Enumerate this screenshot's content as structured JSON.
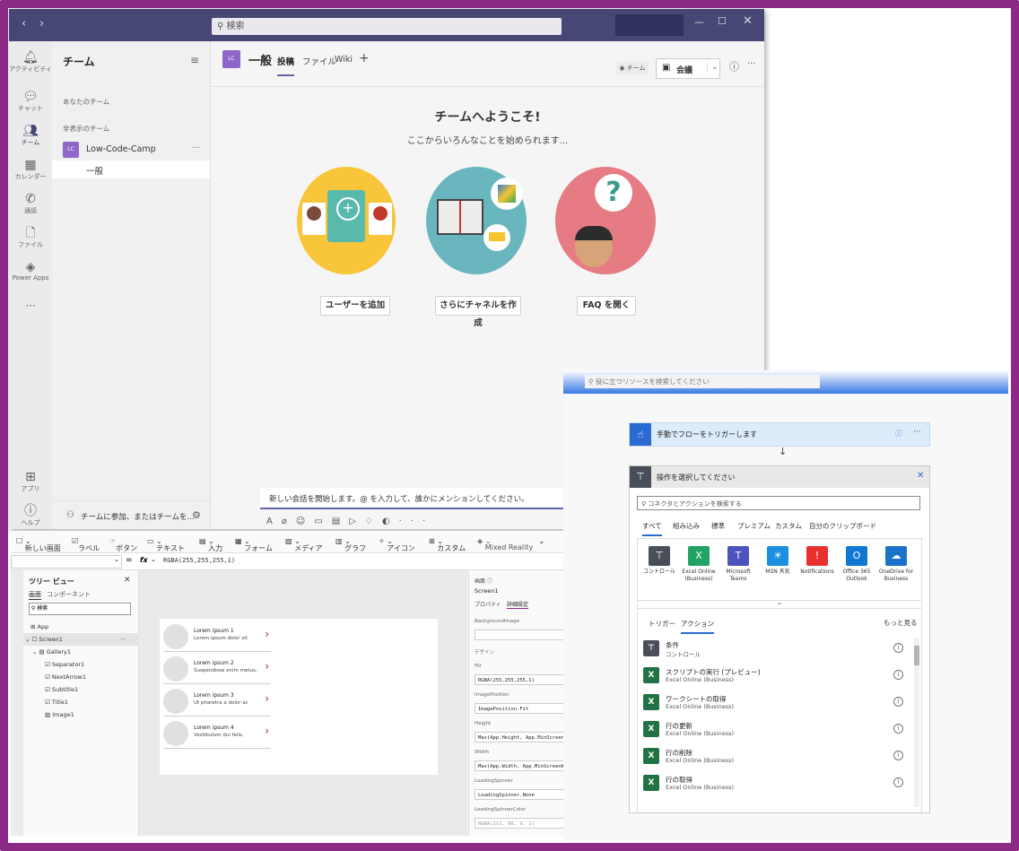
{
  "teams": {
    "search_placeholder": "検索",
    "rail": [
      "アクティビティ",
      "チャット",
      "チーム",
      "カレンダー",
      "通話",
      "ファイル",
      "Power Apps",
      "アプリ",
      "ヘルプ"
    ],
    "list_title": "チーム",
    "section_your_teams": "あなたのチーム",
    "section_hidden": "非表示のチーム",
    "team_badge": "LC",
    "team_name": "Low-Code-Camp",
    "channel_general": "一般",
    "join_text": "チームに参加、またはチームを...",
    "channel_title": "一般",
    "tabs": [
      "投稿",
      "ファイル",
      "Wiki"
    ],
    "team_chip": "チーム",
    "meet_label": "会議",
    "welcome_title": "チームへようこそ!",
    "welcome_sub": "ここからいろんなことを始められます...",
    "actions": [
      "ユーザーを追加",
      "さらにチャネルを作成",
      "FAQ を開く"
    ],
    "compose_placeholder": "新しい会話を開始します。@ を入力して、誰かにメンションしてください。"
  },
  "powerapps": {
    "ribbon": [
      "新しい画面",
      "ラベル",
      "ボタン",
      "テキスト",
      "入力",
      "フォーム",
      "メディア",
      "グラフ",
      "アイコン",
      "カスタム",
      "Mixed Reality"
    ],
    "formula_label": "fx",
    "formula_value": "RGBA(255,255,255,1)",
    "tree_title": "ツリー ビュー",
    "tree_tabs": [
      "画面",
      "コンポーネント"
    ],
    "tree_search": "検索",
    "tree_items": [
      "App",
      "Screen1",
      "Gallery1",
      "Separator1",
      "NextArrow1",
      "Subtitle1",
      "Title1",
      "Image1"
    ],
    "gallery": [
      {
        "title": "Lorem ipsum 1",
        "sub": "Lorem ipsum dolor sit"
      },
      {
        "title": "Lorem ipsum 2",
        "sub": "Suspendisse enim metus,"
      },
      {
        "title": "Lorem ipsum 3",
        "sub": "Ut pharetra a dolor ac"
      },
      {
        "title": "Lorem ipsum 4",
        "sub": "Vestibulum dui felis,"
      }
    ],
    "props_header": "画面",
    "props_screen": "Screen1",
    "props_tabs": [
      "プロパティ",
      "詳細設定"
    ],
    "props": [
      {
        "label": "BackgroundImage",
        "value": ""
      },
      {
        "label": "デザイン",
        "value": ""
      },
      {
        "label": "Fill",
        "value": "RGBA(255,255,255,1)"
      },
      {
        "label": "ImagePosition",
        "value": "ImagePosition.Fit"
      },
      {
        "label": "Height",
        "value": "Max(App.Height, App.MinScreenHeight)"
      },
      {
        "label": "Width",
        "value": "Max(App.Width, App.MinScreenWidth)"
      },
      {
        "label": "LoadingSpinner",
        "value": "LoadingSpinner.None"
      },
      {
        "label": "LoadingSpinnerColor",
        "value": "RGBA(211, 66, 9, 1)"
      }
    ]
  },
  "automate": {
    "search_placeholder": "役に立つリソースを検索してください",
    "trigger_title": "手動でフローをトリガーします",
    "op_title": "操作を選択してください",
    "op_search": "コネクタとアクションを検索する",
    "cat_tabs": [
      "すべて",
      "組み込み",
      "標準",
      "プレミアム",
      "カスタム",
      "自分のクリップボード"
    ],
    "connectors": [
      {
        "label": "コントロール",
        "color": "#484f58",
        "icon": "⊤"
      },
      {
        "label": "Excel Online (Business)",
        "color": "#21a366",
        "icon": "X"
      },
      {
        "label": "Microsoft Teams",
        "color": "#4b53bc",
        "icon": "T"
      },
      {
        "label": "MSN 天気",
        "color": "#1b8ee0",
        "icon": "☀"
      },
      {
        "label": "Notifications",
        "color": "#e8312f",
        "icon": "🔔"
      },
      {
        "label": "Office 365 Outlook",
        "color": "#0f78d4",
        "icon": "O"
      },
      {
        "label": "OneDrive for Business",
        "color": "#1a73c8",
        "icon": "☁"
      }
    ],
    "sub_tabs": [
      "トリガー",
      "アクション"
    ],
    "see_more": "もっと見る",
    "actions": [
      {
        "title": "条件",
        "sub": "コントロール",
        "color": "#484f58",
        "icon": "⊤"
      },
      {
        "title": "スクリプトの実行 (プレビュー)",
        "sub": "Excel Online (Business)",
        "color": "#217346",
        "icon": "X"
      },
      {
        "title": "ワークシートの取得",
        "sub": "Excel Online (Business)",
        "color": "#217346",
        "icon": "X"
      },
      {
        "title": "行の更新",
        "sub": "Excel Online (Business)",
        "color": "#217346",
        "icon": "X"
      },
      {
        "title": "行の削除",
        "sub": "Excel Online (Business)",
        "color": "#217346",
        "icon": "X"
      },
      {
        "title": "行の取得",
        "sub": "Excel Online (Business)",
        "color": "#217346",
        "icon": "X"
      }
    ]
  }
}
